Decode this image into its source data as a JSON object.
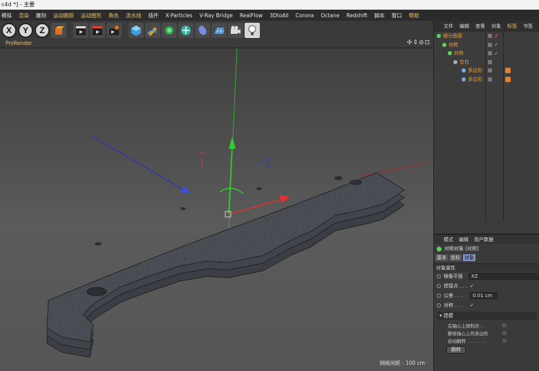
{
  "window": {
    "title": "c4d *] - 主要"
  },
  "menubar": [
    {
      "label": "模拟",
      "highlight": false
    },
    {
      "label": "渲染",
      "highlight": true
    },
    {
      "label": "雕刻",
      "highlight": false
    },
    {
      "label": "运动跟踪",
      "highlight": true
    },
    {
      "label": "运动图形",
      "highlight": true
    },
    {
      "label": "角色",
      "highlight": true
    },
    {
      "label": "流水线",
      "highlight": true
    },
    {
      "label": "插件",
      "highlight": false
    },
    {
      "label": "X-Particles",
      "highlight": false
    },
    {
      "label": "V-Ray Bridge",
      "highlight": false
    },
    {
      "label": "RealFlow",
      "highlight": false
    },
    {
      "label": "3DtoAll",
      "highlight": false
    },
    {
      "label": "Corona",
      "highlight": false
    },
    {
      "label": "Octane",
      "highlight": false
    },
    {
      "label": "Redshift",
      "highlight": false
    },
    {
      "label": "脚本",
      "highlight": false
    },
    {
      "label": "窗口",
      "highlight": false
    },
    {
      "label": "帮助",
      "highlight": true
    }
  ],
  "toolbar": {
    "axis_x": "X",
    "axis_y": "Y",
    "axis_z": "Z"
  },
  "viewport": {
    "tab_label": "ProRender",
    "nav_icons": "✣⇕⊘⊡",
    "grid_label": "网格间距 : 100 cm"
  },
  "object_manager": {
    "tabs": [
      {
        "label": "文件",
        "active": false
      },
      {
        "label": "编辑",
        "active": false
      },
      {
        "label": "查看",
        "active": false
      },
      {
        "label": "对象",
        "active": false
      },
      {
        "label": "标签",
        "active": true
      },
      {
        "label": "书签",
        "active": false
      }
    ],
    "rows": [
      {
        "name": "细分曲面",
        "indent": 0,
        "color": "#f0a030",
        "dot": "#5cd35c",
        "flag": "✗",
        "flag_color": "#e04040"
      },
      {
        "name": "对称",
        "indent": 8,
        "color": "#f0a030",
        "dot": "#5cd35c",
        "flag": "✓",
        "flag_color": "#5cd35c"
      },
      {
        "name": "对称",
        "indent": 16,
        "color": "#f0a030",
        "dot": "#5cd35c",
        "flag": "✓",
        "flag_color": "#5cd35c"
      },
      {
        "name": "空白",
        "indent": 24,
        "color": "#f0a030",
        "dot": "#aaa",
        "flag": "",
        "flag_color": "#aaa"
      },
      {
        "name": "多边形",
        "indent": 36,
        "color": "#f0a030",
        "dot": "#7aa7e8",
        "flag": "",
        "flag_color": "#aaa"
      },
      {
        "name": "多边形",
        "indent": 36,
        "color": "#f0a030",
        "dot": "#7aa7e8",
        "flag": "",
        "flag_color": "#aaa"
      }
    ]
  },
  "attribute_manager": {
    "tabs": [
      "模式",
      "编辑",
      "用户数据"
    ],
    "title": "对称对象 [对称]",
    "subtabs": [
      {
        "label": "基本",
        "active": false
      },
      {
        "label": "坐标",
        "active": false
      },
      {
        "label": "对象",
        "active": true
      }
    ],
    "section": "对象属性",
    "props": [
      {
        "label": "镜像平面",
        "value": "XZ"
      },
      {
        "label": "焊接点 . . .",
        "value": "✓"
      },
      {
        "label": "公差 . . .",
        "value": "0.01 cm"
      },
      {
        "label": "对称 . . .",
        "value": "✓"
      }
    ],
    "subhead": "▾ 建模",
    "subs": [
      "在轴心上限制点 . .",
      "删除轴心上的多边形",
      "自动翻转 . . . . . . ."
    ],
    "flip_button": "翻转"
  }
}
